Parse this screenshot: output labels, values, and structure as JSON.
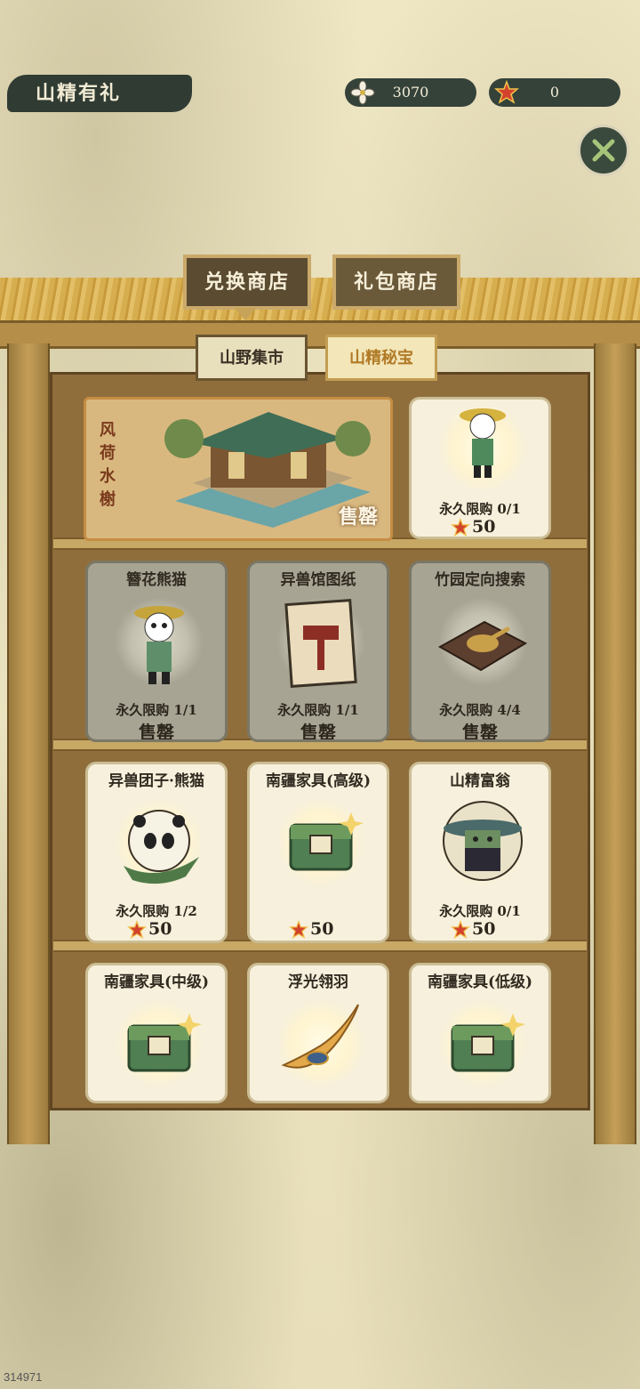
{
  "header": {
    "title": "山精有礼",
    "currency_flower": "3070",
    "currency_star": "0"
  },
  "tabs": {
    "main": [
      "兑换商店",
      "礼包商店"
    ],
    "sub": [
      "山野集市",
      "山精秘宝"
    ]
  },
  "featured": {
    "name": "风荷水榭",
    "status": "售罄"
  },
  "top_right_card": {
    "limit": "永久限购 0/1",
    "price": "50"
  },
  "cards": [
    {
      "name": "簪花熊猫",
      "limit": "永久限购 1/1",
      "status": "售罄"
    },
    {
      "name": "异兽馆图纸",
      "limit": "永久限购 1/1",
      "status": "售罄"
    },
    {
      "name": "竹园定向搜索",
      "limit": "永久限购 4/4",
      "status": "售罄"
    },
    {
      "name": "异兽团子·熊猫",
      "limit": "永久限购 1/2",
      "price": "50"
    },
    {
      "name": "南疆家具(高级)",
      "price": "50"
    },
    {
      "name": "山精富翁",
      "limit": "永久限购 0/1",
      "price": "50"
    },
    {
      "name": "南疆家具(中级)"
    },
    {
      "name": "浮光翎羽"
    },
    {
      "name": "南疆家具(低级)"
    }
  ],
  "watermark": "314971",
  "colors": {
    "accent": "#b07a26",
    "dark_panel": "#2f3b33"
  }
}
